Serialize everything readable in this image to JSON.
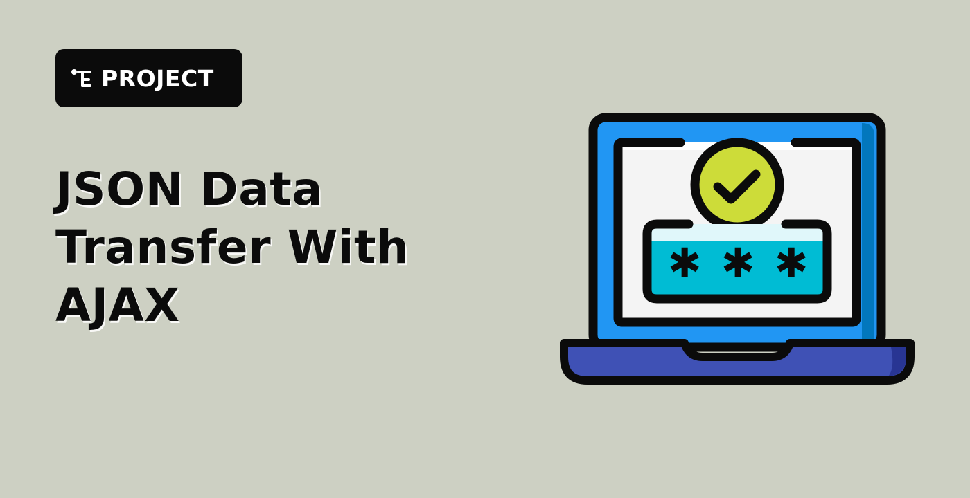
{
  "badge": {
    "label": "PROJECT",
    "icon": "project-tree-icon"
  },
  "title": {
    "lines": [
      "JSON Data",
      "Transfer With",
      "AJAX"
    ]
  },
  "illustration": {
    "name": "laptop-password-check",
    "password_mask": [
      "✱",
      "✱",
      "✱"
    ]
  },
  "colors": {
    "background": "#cdd0c3",
    "badge_background": "#0b0b0b",
    "text": "#0b0b0b",
    "laptop_frame": "#2196f3",
    "laptop_frame_dark": "#0277bd",
    "laptop_base": "#3f51b5",
    "screen": "#f4f4f4",
    "check_circle": "#cddc39",
    "password_field": "#00bcd4",
    "outline": "#0b0b0b"
  }
}
